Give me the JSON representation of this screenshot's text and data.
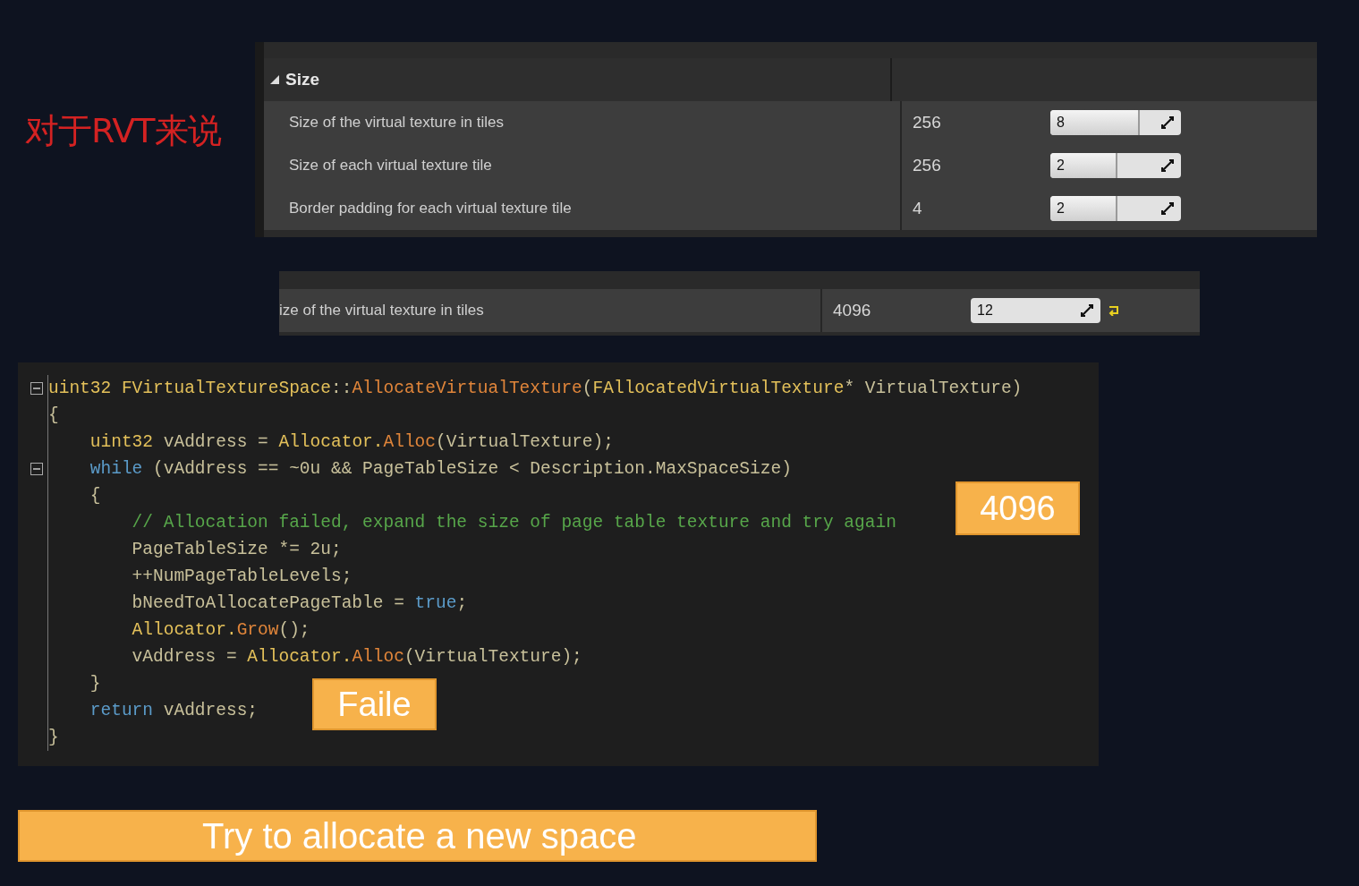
{
  "heading": "对于RVT来说",
  "property_panels": [
    {
      "section": {
        "title": "Size",
        "expanded": true
      },
      "rows": [
        {
          "name": "Size of the virtual texture in tiles",
          "value": "256",
          "spin": "8",
          "level": 0.67
        },
        {
          "name": "Size of each virtual texture tile",
          "value": "256",
          "spin": "2",
          "level": 0.5
        },
        {
          "name": "Border padding for each virtual texture tile",
          "value": "4",
          "spin": "2",
          "level": 0.5
        }
      ]
    },
    {
      "rows": [
        {
          "name": "ize of the virtual texture in tiles",
          "value": "4096",
          "spin": "12",
          "reset": true
        }
      ]
    }
  ],
  "code": {
    "lines": [
      {
        "foldable": true,
        "tokens": [
          {
            "kind": "type",
            "text": "uint32 "
          },
          {
            "kind": "type",
            "text": "FVirtualTextureSpace"
          },
          {
            "kind": "plain",
            "text": "::"
          },
          {
            "kind": "func",
            "text": "AllocateVirtualTexture"
          },
          {
            "kind": "plain",
            "text": "("
          },
          {
            "kind": "type",
            "text": "FAllocatedVirtualTexture"
          },
          {
            "kind": "plain",
            "text": "* VirtualTexture)"
          }
        ]
      },
      {
        "foldable": false,
        "tokens": [
          {
            "kind": "plain",
            "text": "{"
          }
        ]
      },
      {
        "foldable": false,
        "tokens": [
          {
            "kind": "type",
            "text": "    uint32 "
          },
          {
            "kind": "plain",
            "text": "vAddress = "
          },
          {
            "kind": "type",
            "text": "Allocator."
          },
          {
            "kind": "func",
            "text": "Alloc"
          },
          {
            "kind": "plain",
            "text": "(VirtualTexture);"
          }
        ]
      },
      {
        "foldable": true,
        "tokens": [
          {
            "kind": "keyword",
            "text": "    while"
          },
          {
            "kind": "plain",
            "text": " (vAddress == ~0u && PageTableSize < Description.MaxSpaceSize)"
          }
        ]
      },
      {
        "foldable": false,
        "tokens": [
          {
            "kind": "plain",
            "text": "    {"
          }
        ]
      },
      {
        "foldable": false,
        "tokens": [
          {
            "kind": "comment",
            "text": "        // Allocation failed, expand the size of page table texture and try again"
          }
        ]
      },
      {
        "foldable": false,
        "tokens": [
          {
            "kind": "plain",
            "text": "        PageTableSize *= 2u;"
          }
        ]
      },
      {
        "foldable": false,
        "tokens": [
          {
            "kind": "plain",
            "text": "        ++NumPageTableLevels;"
          }
        ]
      },
      {
        "foldable": false,
        "tokens": [
          {
            "kind": "plain",
            "text": "        bNeedToAllocatePageTable = "
          },
          {
            "kind": "keyword",
            "text": "true"
          },
          {
            "kind": "plain",
            "text": ";"
          }
        ]
      },
      {
        "foldable": false,
        "tokens": [
          {
            "kind": "type",
            "text": "        Allocator."
          },
          {
            "kind": "func",
            "text": "Grow"
          },
          {
            "kind": "plain",
            "text": "();"
          }
        ]
      },
      {
        "foldable": false,
        "tokens": [
          {
            "kind": "plain",
            "text": "        vAddress = "
          },
          {
            "kind": "type",
            "text": "Allocator."
          },
          {
            "kind": "func",
            "text": "Alloc"
          },
          {
            "kind": "plain",
            "text": "(VirtualTexture);"
          }
        ]
      },
      {
        "foldable": false,
        "tokens": [
          {
            "kind": "plain",
            "text": "    }"
          }
        ]
      },
      {
        "foldable": false,
        "tokens": [
          {
            "kind": "keyword",
            "text": "    return"
          },
          {
            "kind": "plain",
            "text": " vAddress;"
          }
        ]
      },
      {
        "foldable": false,
        "tokens": [
          {
            "kind": "plain",
            "text": "}"
          }
        ]
      }
    ]
  },
  "callouts": [
    {
      "text": "4096",
      "kind": "box"
    },
    {
      "text": "Faile",
      "kind": "box"
    },
    {
      "text": "Try to allocate a new space",
      "kind": "banner"
    }
  ]
}
